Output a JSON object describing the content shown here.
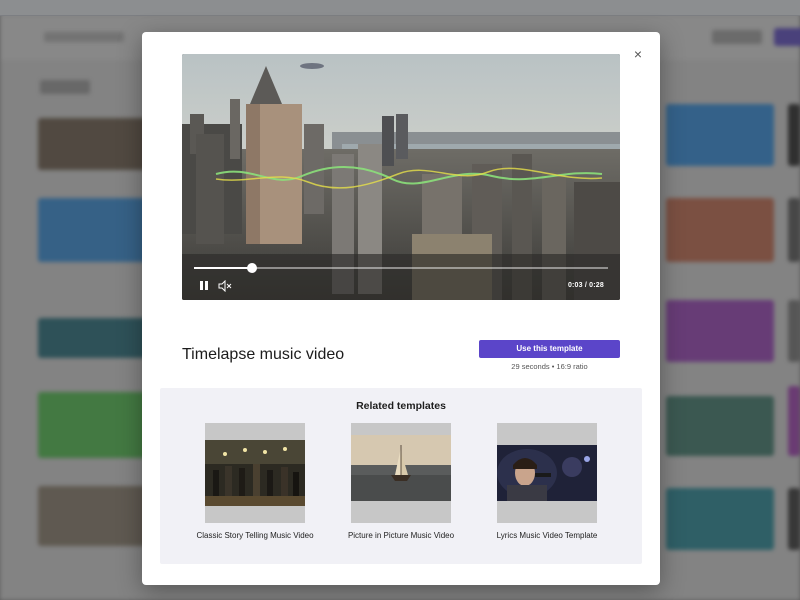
{
  "modal": {
    "close_glyph": "×",
    "title": "Timelapse music video",
    "use_button": "Use this template",
    "meta": "29 seconds • 16:9 ratio"
  },
  "player": {
    "time": "0:03 / 0:28",
    "progress": 0.14,
    "state": "playing"
  },
  "related": {
    "heading": "Related templates",
    "items": [
      {
        "label": "Classic Story Telling Music Video",
        "icon": "concert-crowd-thumbnail"
      },
      {
        "label": "Picture in Picture Music Video",
        "icon": "ship-at-sea-thumbnail"
      },
      {
        "label": "Lyrics Music Video Template",
        "icon": "singer-microphone-thumbnail"
      }
    ]
  },
  "colors": {
    "accent": "#5b45c9",
    "overlay": "#3c3c3c"
  }
}
